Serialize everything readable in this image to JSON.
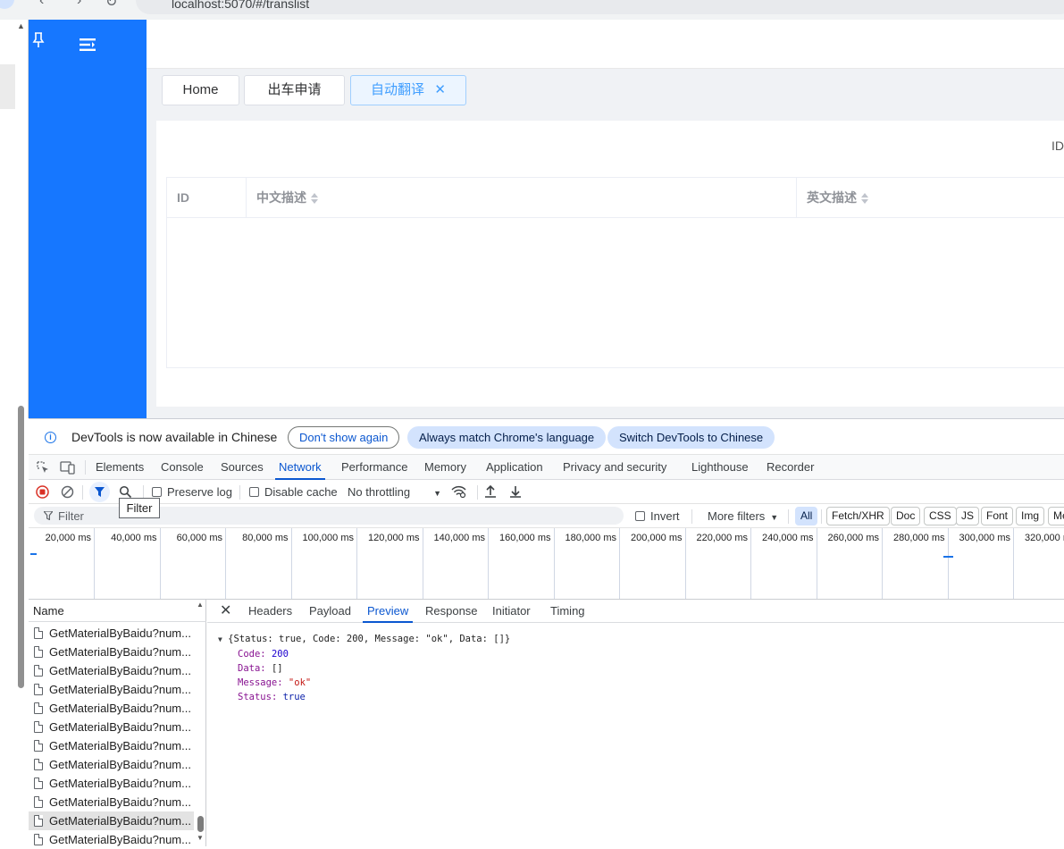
{
  "browser": {
    "url": "localhost:5070/#/translist"
  },
  "app": {
    "tabs": [
      {
        "label": "Home"
      },
      {
        "label": "出车申请"
      },
      {
        "label": "自动翻译",
        "active": true
      }
    ],
    "filter_label_cut": "ID",
    "table": {
      "columns": [
        {
          "label": "ID"
        },
        {
          "label": "中文描述"
        },
        {
          "label": "英文描述"
        }
      ],
      "rows": []
    },
    "sidebar_color": "#1677ff"
  },
  "devtools": {
    "infobar": {
      "message": "DevTools is now available in Chinese",
      "buttons": [
        "Don't show again",
        "Always match Chrome's language",
        "Switch DevTools to Chinese"
      ]
    },
    "panel_tabs": [
      "Elements",
      "Console",
      "Sources",
      "Network",
      "Performance",
      "Memory",
      "Application",
      "Privacy and security",
      "Lighthouse",
      "Recorder"
    ],
    "active_panel": "Network",
    "toolbar": {
      "preserve_log": "Preserve log",
      "disable_cache": "Disable cache",
      "throttling": "No throttling",
      "filter_tooltip": "Filter"
    },
    "filter_bar": {
      "placeholder": "Filter",
      "invert": "Invert",
      "more_filters": "More filters",
      "type_chips": [
        "All",
        "Fetch/XHR",
        "Doc",
        "CSS",
        "JS",
        "Font",
        "Img",
        "Me"
      ]
    },
    "timeline_ticks": [
      "20,000 ms",
      "40,000 ms",
      "60,000 ms",
      "80,000 ms",
      "100,000 ms",
      "120,000 ms",
      "140,000 ms",
      "160,000 ms",
      "180,000 ms",
      "200,000 ms",
      "220,000 ms",
      "240,000 ms",
      "260,000 ms",
      "280,000 ms",
      "300,000 ms",
      "320,000 ms"
    ],
    "name_header": "Name",
    "requests": [
      "GetMaterialByBaidu?num...",
      "GetMaterialByBaidu?num...",
      "GetMaterialByBaidu?num...",
      "GetMaterialByBaidu?num...",
      "GetMaterialByBaidu?num...",
      "GetMaterialByBaidu?num...",
      "GetMaterialByBaidu?num...",
      "GetMaterialByBaidu?num...",
      "GetMaterialByBaidu?num...",
      "GetMaterialByBaidu?num...",
      "GetMaterialByBaidu?num...",
      "GetMaterialByBaidu?num..."
    ],
    "selected_request_index": 10,
    "detail_tabs": [
      "Headers",
      "Payload",
      "Preview",
      "Response",
      "Initiator",
      "Timing"
    ],
    "active_detail_tab": "Preview",
    "preview": {
      "summary": "{Status: true, Code: 200, Message: \"ok\", Data: []}",
      "fields": [
        {
          "key": "Code",
          "value": "200",
          "kind": "num"
        },
        {
          "key": "Data",
          "value": "[]",
          "kind": "plain"
        },
        {
          "key": "Message",
          "value": "\"ok\"",
          "kind": "str"
        },
        {
          "key": "Status",
          "value": "true",
          "kind": "bool"
        }
      ]
    }
  }
}
